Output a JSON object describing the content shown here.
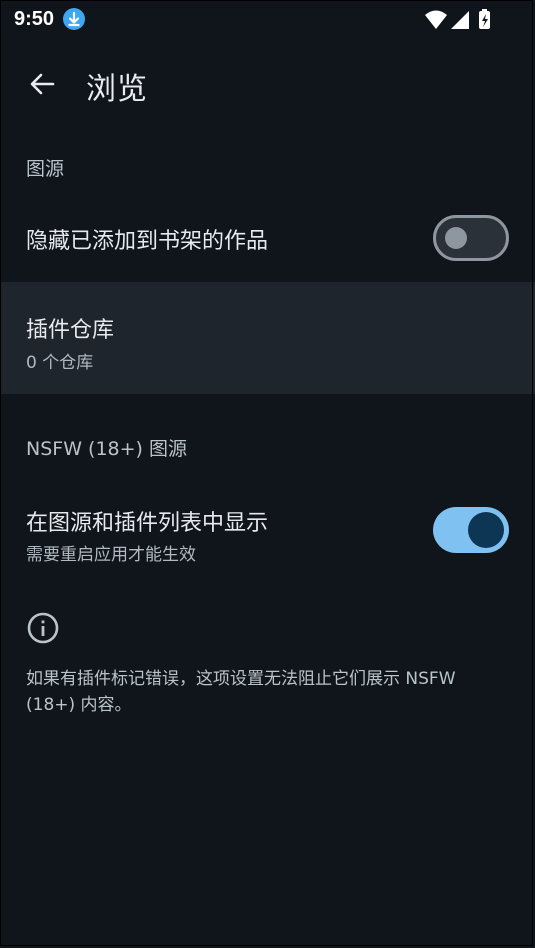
{
  "status_bar": {
    "time": "9:50"
  },
  "app_bar": {
    "title": "浏览"
  },
  "sources_section": {
    "header": "图源",
    "hide_in_library": {
      "label": "隐藏已添加到书架的作品",
      "enabled": false
    },
    "extension_repos": {
      "label": "插件仓库",
      "summary": "0 个仓库"
    }
  },
  "nsfw_section": {
    "header": "NSFW (18+) 图源",
    "show_in_lists": {
      "label": "在图源和插件列表中显示",
      "summary": "需要重启应用才能生效",
      "enabled": true
    },
    "info_text": "如果有插件标记错误，这项设置无法阻止它们展示 NSFW (18+) 内容。"
  },
  "colors": {
    "background": "#0f151b",
    "accent": "#7fc2f2",
    "highlight_row": "#1f252c"
  }
}
